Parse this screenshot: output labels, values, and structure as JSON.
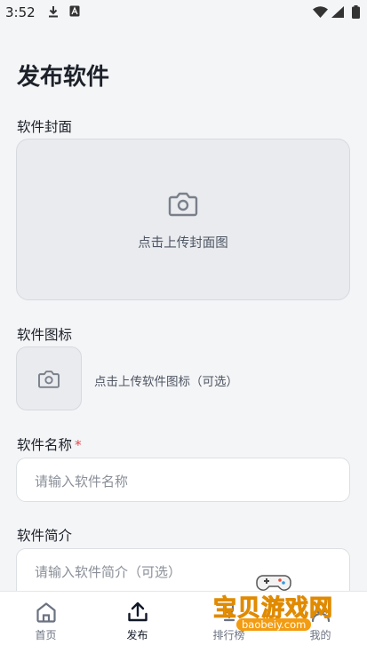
{
  "status_bar": {
    "time": "3:52"
  },
  "page": {
    "title": "发布软件"
  },
  "cover": {
    "label": "软件封面",
    "upload_text": "点击上传封面图"
  },
  "app_icon": {
    "label": "软件图标",
    "upload_text": "点击上传软件图标（可选）"
  },
  "name_field": {
    "label": "软件名称",
    "required_mark": "*",
    "placeholder": "请输入软件名称"
  },
  "intro_field": {
    "label": "软件简介",
    "placeholder": "请输入软件简介（可选）"
  },
  "tabs": [
    {
      "label": "首页",
      "icon": "home-icon"
    },
    {
      "label": "发布",
      "icon": "upload-icon",
      "active": true
    },
    {
      "label": "排行榜",
      "icon": "ranking-icon"
    },
    {
      "label": "我的",
      "icon": "profile-icon"
    }
  ],
  "watermark": {
    "title": "宝贝游戏网",
    "url": "baobeiy.com"
  },
  "colors": {
    "background": "#f4f5f7",
    "required": "#e5484d",
    "active_tab": "#111827",
    "inactive_tab": "#6b7280"
  }
}
